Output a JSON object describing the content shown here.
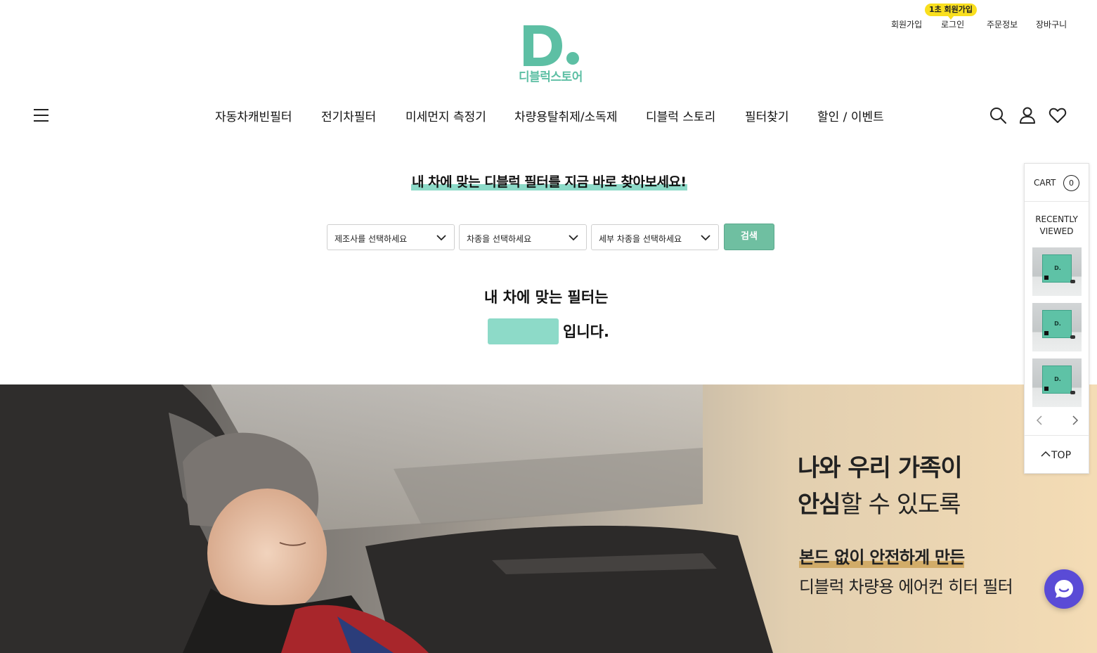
{
  "header": {
    "util_links": [
      "회원가입",
      "로그인",
      "주문정보",
      "장바구니"
    ],
    "promo_badge": "1초 회원가입",
    "logo_text": "디블럭스토어"
  },
  "nav": {
    "items": [
      "자동차캐빈필터",
      "전기차필터",
      "미세먼지 측정기",
      "차량용탈취제/소독제",
      "디블럭 스토리",
      "필터찾기",
      "할인 / 이벤트"
    ],
    "icons": [
      "menu-icon",
      "search-icon",
      "user-icon",
      "heart-icon"
    ]
  },
  "finder": {
    "title": "내 차에 맞는 디블럭 필터를 지금 바로 찾아보세요!",
    "select_manufacturer": "제조사를 선택하세요",
    "select_model": "차종을 선택하세요",
    "select_detail": "세부 차종을 선택하세요",
    "search_button": "검색",
    "result_line1": "내 차에 맞는 필터는",
    "result_suffix": "입니다.",
    "accent_color": "#8ddac8"
  },
  "banner": {
    "headline_line1": "나와 우리 가족이",
    "headline_line2_bold": "안심",
    "headline_line2_rest": "할 수 있도록",
    "sub_line1": "본드 없이 안전하게 만든",
    "sub_line2": "디블럭 차량용 에어컨 히터 필터"
  },
  "quick": {
    "cart_label": "CART",
    "cart_count": "0",
    "recent_line1": "RECENTLY",
    "recent_line2": "VIEWED",
    "thumb_logo": "D.",
    "top_label": "TOP"
  },
  "colors": {
    "brand": "#5dbfa4",
    "search_button": "#6fbfa1",
    "chat": "#5a4bd6",
    "badge": "#f9df1e"
  }
}
